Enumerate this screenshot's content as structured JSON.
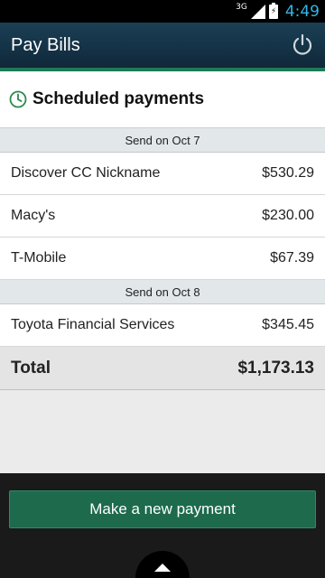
{
  "status_bar": {
    "network": "3G",
    "time": "4:49"
  },
  "header": {
    "title": "Pay Bills",
    "power_icon": "power-icon"
  },
  "section": {
    "title": "Scheduled payments",
    "icon": "clock-icon"
  },
  "groups": [
    {
      "label": "Send on Oct 7",
      "payments": [
        {
          "payee": "Discover CC Nickname",
          "amount": "$530.29"
        },
        {
          "payee": "Macy's",
          "amount": "$230.00"
        },
        {
          "payee": "T-Mobile",
          "amount": "$67.39"
        }
      ]
    },
    {
      "label": "Send on Oct 8",
      "payments": [
        {
          "payee": "Toyota Financial Services",
          "amount": "$345.45"
        }
      ]
    }
  ],
  "total": {
    "label": "Total",
    "amount": "$1,173.13"
  },
  "actions": {
    "new_payment_label": "Make a new payment"
  },
  "colors": {
    "accent": "#1e7a57",
    "action_bar": "#1b3f55",
    "button": "#1d6a4d"
  }
}
